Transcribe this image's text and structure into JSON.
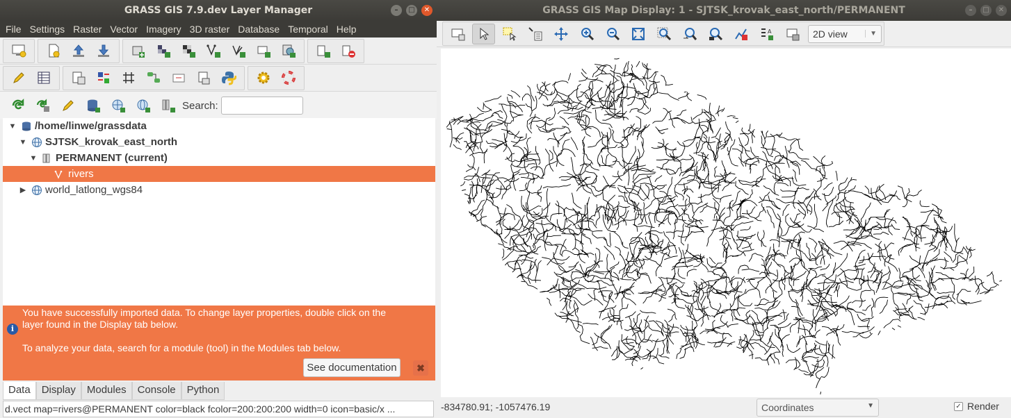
{
  "layer_manager": {
    "title": "GRASS GIS 7.9.dev Layer Manager",
    "menu": [
      "File",
      "Settings",
      "Raster",
      "Vector",
      "Imagery",
      "3D raster",
      "Database",
      "Temporal",
      "Help"
    ],
    "search_label": "Search:",
    "search_value": "",
    "tree": {
      "root": "/home/linwe/grassdata",
      "location": "SJTSK_krovak_east_north",
      "mapset": "PERMANENT  (current)",
      "layer": "rivers",
      "other_location": "world_latlong_wgs84"
    },
    "info": {
      "line1": "You have successfully imported data. To change layer properties, double click on the layer found in the Display tab below.",
      "line2": "To analyze your data, search for a module (tool) in the Modules tab below.",
      "doc_button": "See documentation",
      "close": "✖"
    },
    "tabs": [
      "Data",
      "Display",
      "Modules",
      "Console",
      "Python"
    ],
    "command": "d.vect map=rivers@PERMANENT color=black fcolor=200:200:200 width=0 icon=basic/x ..."
  },
  "map_display": {
    "title": "GRASS GIS Map Display: 1 - SJTSK_krovak_east_north/PERMANENT",
    "view_mode": "2D view",
    "coordinates": "-834780.91; -1057476.19",
    "status_mode": "Coordinates",
    "render_label": "Render",
    "render_checked": true
  },
  "colors": {
    "accent": "#f07746",
    "titlebar": "#3c3b37",
    "window_bg": "#efefef"
  }
}
